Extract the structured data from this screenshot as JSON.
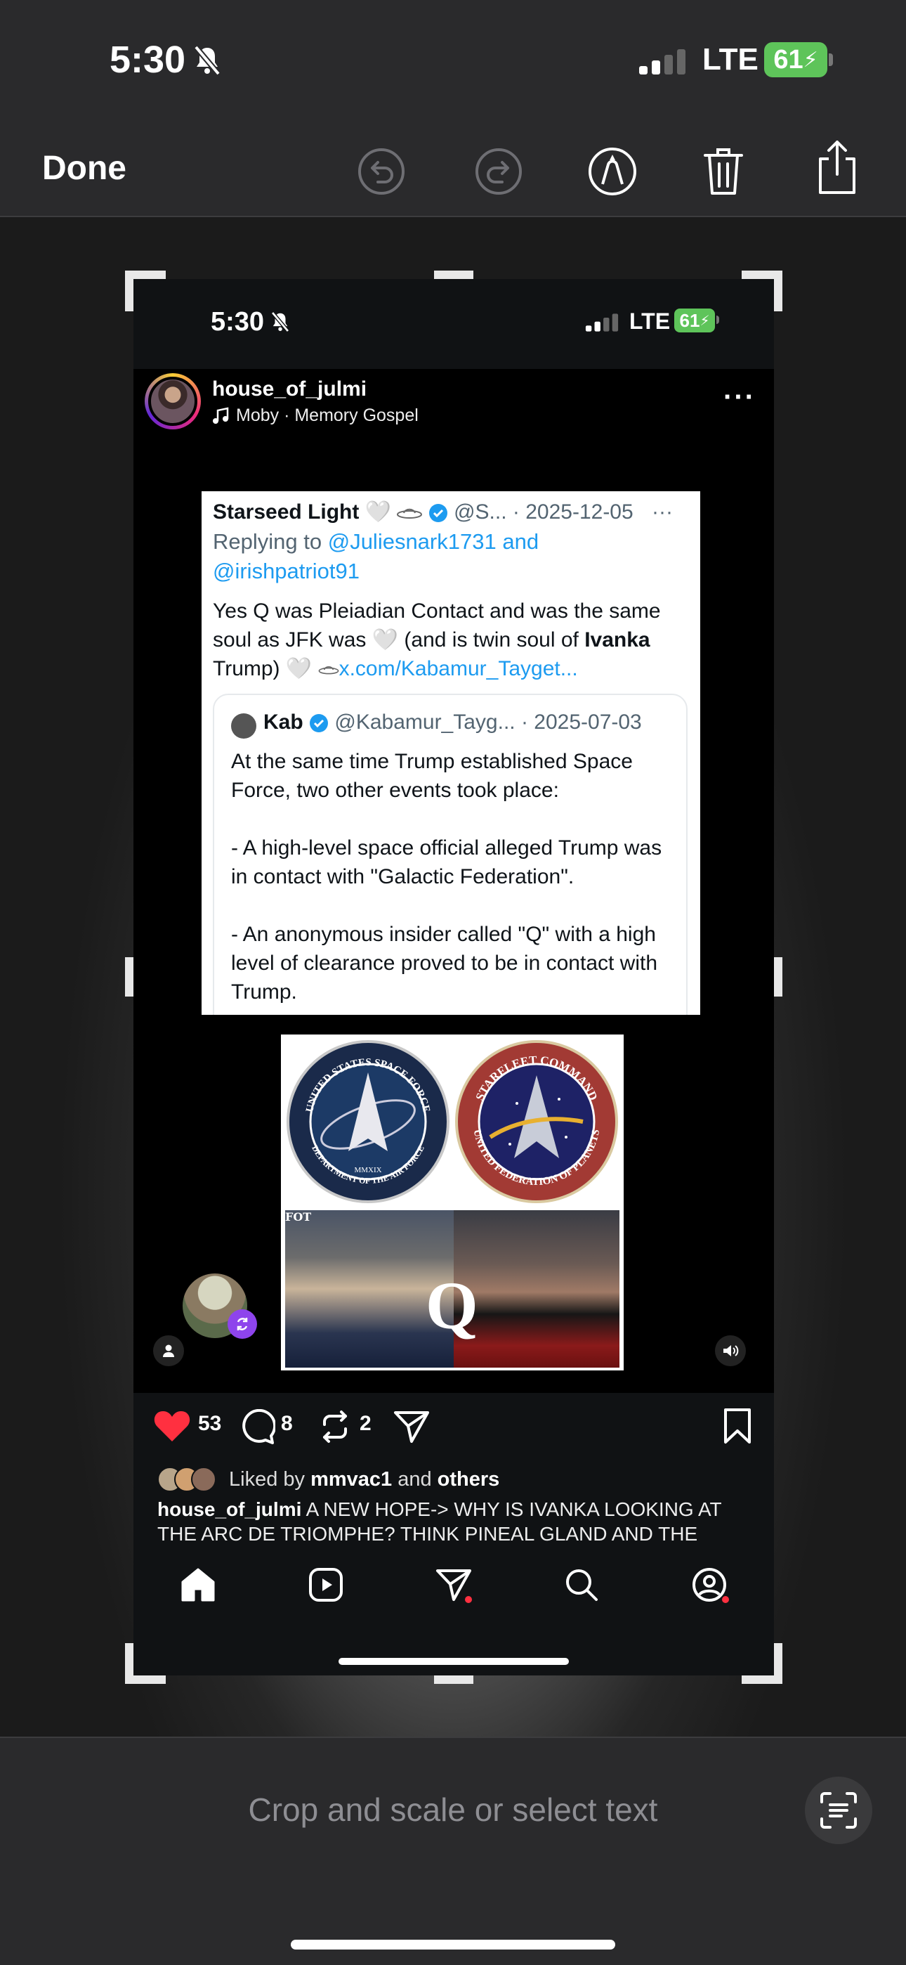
{
  "status_bar": {
    "time": "5:30",
    "network": "LTE",
    "battery": "61"
  },
  "toolbar": {
    "done_label": "Done"
  },
  "inner_status_bar": {
    "time": "5:30",
    "network": "LTE",
    "battery": "61"
  },
  "post": {
    "username": "house_of_julmi",
    "audio": "Moby · Memory Gospel",
    "more": "···",
    "tweet": {
      "author": "Starseed Light 🤍",
      "handle_date": "@S... · 2025-12-05",
      "more": "···",
      "replying_prefix": "Replying to ",
      "replying_handle1": "@Juliesnark1731",
      "replying_and": " and",
      "replying_handle2": "@irishpatriot91",
      "body_part1": "Yes Q was Pleiadian Contact and was the same soul as JFK was 🤍 (and is twin soul of ",
      "body_bold": "Ivanka",
      "body_part2": " Trump) 🤍 ",
      "body_link": "x.com/Kabamur_Tayget...",
      "quote": {
        "author": "Kab",
        "handle_date": "@Kabamur_Tayg... · 2025-07-03",
        "para1": "At the same time Trump established Space Force, two other events took place:",
        "para2": "- A high-level space official alleged Trump was in contact with \"Galactic Federation\".",
        "para3": "- An anonymous insider called \"Q\" with a high level of clearance proved to be in contact with Trump."
      }
    },
    "collage": {
      "seal1_top": "UNITED STATES SPACE FORCE",
      "seal1_bottom": "DEPARTMENT OF THE AIR FORCE",
      "seal1_year": "MMXIX",
      "seal2_top": "STARFLEET COMMAND",
      "seal2_bottom": "UNITED FEDERATION OF PLANETS",
      "fot": "FOT",
      "q": "Q"
    },
    "likes": "53",
    "comments": "8",
    "reposts": "2",
    "liked_by_prefix": "Liked by ",
    "liked_by_user": "mmvac1",
    "liked_by_and": " and ",
    "liked_by_others": "others",
    "caption_user": "house_of_julmi",
    "caption_text": " A NEW HOPE-> WHY IS IVANKA LOOKING AT THE ARC DE TRIOMPHE? THINK PINEAL GLAND AND THE"
  },
  "crop_hint": "Crop and scale or select text",
  "colors": {
    "like": "#ff3040",
    "battery": "#5ec45a",
    "link": "#1d9bf0",
    "verified": "#1d9bf0",
    "repost_badge": "#8e44ec"
  }
}
